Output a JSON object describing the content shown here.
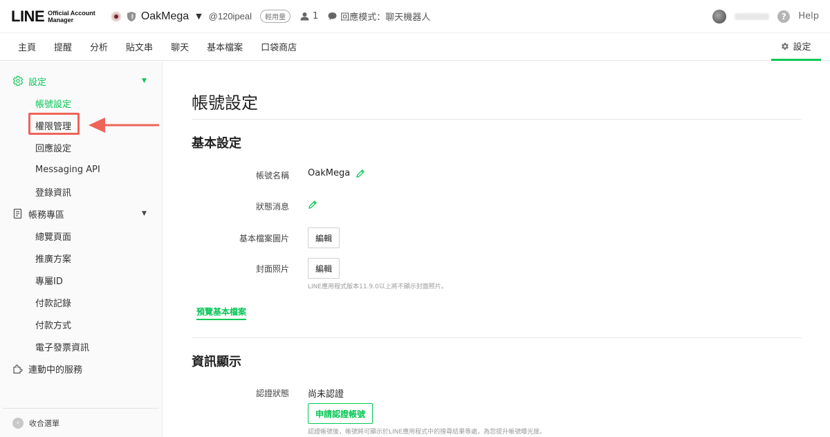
{
  "header": {
    "logo": {
      "main": "LINE",
      "sub_line1": "Official Account",
      "sub_line2": "Manager"
    },
    "account_name": "OakMega",
    "account_id": "@120ipeal",
    "plan_badge": "輕用量",
    "member_count": "1",
    "chat_mode": "回應模式：聊天機器人",
    "help_label": "Help"
  },
  "tabs": {
    "items": [
      "主頁",
      "提醒",
      "分析",
      "貼文串",
      "聊天",
      "基本檔案",
      "口袋商店"
    ],
    "settings_label": "設定"
  },
  "sidebar": {
    "settings_group": "設定",
    "settings_items": [
      "帳號設定",
      "權限管理",
      "回應設定",
      "Messaging API",
      "登錄資訊"
    ],
    "billing_group": "帳務專區",
    "billing_items": [
      "總覽頁面",
      "推廣方案",
      "專屬ID",
      "付款記錄",
      "付款方式",
      "電子發票資訊"
    ],
    "linked_services": "連動中的服務",
    "collapse_label": "收合選單"
  },
  "main": {
    "page_title": "帳號設定",
    "basic_section_title": "基本設定",
    "rows": {
      "account_name_label": "帳號名稱",
      "account_name_value": "OakMega",
      "status_label": "狀態消息",
      "profile_image_label": "基本檔案圖片",
      "cover_label": "封面照片",
      "edit_button": "編輯"
    },
    "cover_note": "LINE應用程式版本11.9.0以上將不顯示封面照片。",
    "preview_link": "預覽基本檔案",
    "info_section_title": "資訊顯示",
    "verify_label": "認證狀態",
    "verify_value": "尚未認證",
    "verify_button": "申請認證帳號",
    "verify_note": "認證帳號後，帳號將可顯示於LINE應用程式中的搜尋結果等處，為您提升帳號曝光度。"
  },
  "colors": {
    "accent": "#06c755",
    "annotation": "#ef6458"
  }
}
